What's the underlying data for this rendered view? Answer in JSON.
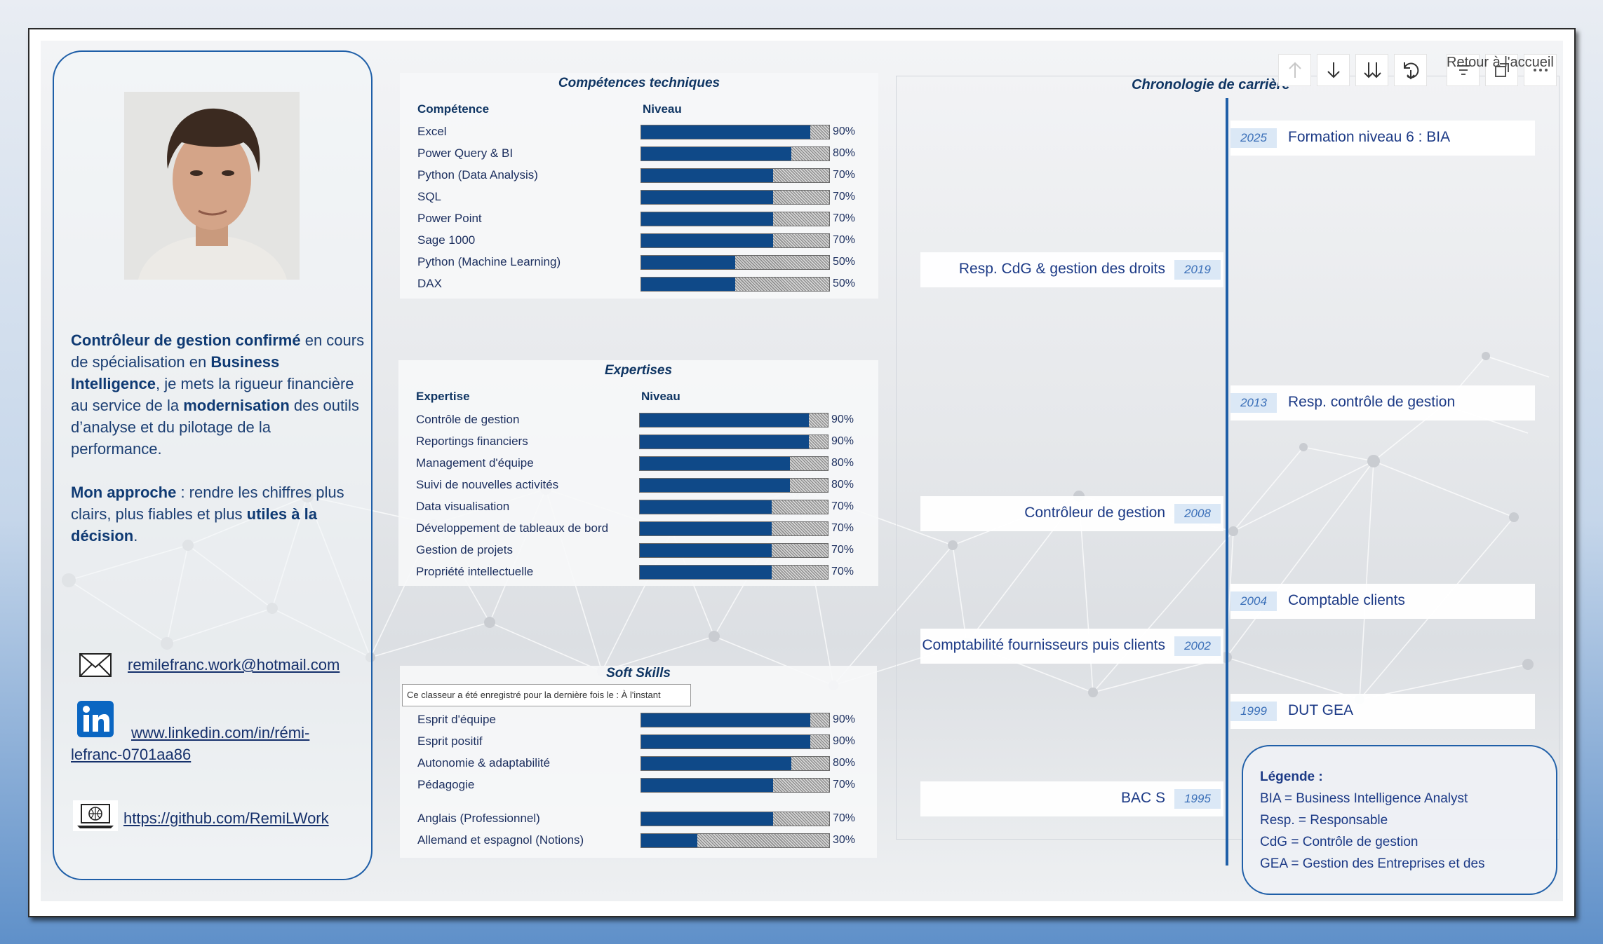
{
  "colors": {
    "accent": "#1f5fa8",
    "bar_fill": "#0f4988",
    "title": "#0f3563",
    "year_badge": "#dbe8f6"
  },
  "profile": {
    "bio_parts": [
      {
        "text": "Contrôleur de gestion confirmé",
        "bold": true
      },
      {
        "text": " en cours de spécialisation en ",
        "bold": false
      },
      {
        "text": "Business Intelligence",
        "bold": true
      },
      {
        "text": ", je mets la rigueur financière au service de la ",
        "bold": false
      },
      {
        "text": "modernisation",
        "bold": true
      },
      {
        "text": " des outils d’analyse et du pilotage de la performance.",
        "bold": false
      }
    ],
    "approach_parts": [
      {
        "text": "Mon approche",
        "bold": true
      },
      {
        "text": " : rendre les chiffres plus clairs, plus fiables et plus ",
        "bold": false
      },
      {
        "text": "utiles à la décision",
        "bold": true
      },
      {
        "text": ".",
        "bold": false
      }
    ],
    "email": "remilefranc.work@hotmail.com",
    "linkedin": "www.linkedin.com/in/rémi-lefranc-0701aa86",
    "github": "https://github.com/RemiLWork",
    "email_icon": "envelope-icon",
    "linkedin_icon": "linkedin-icon",
    "github_icon": "laptop-globe-icon"
  },
  "technical": {
    "title": "Compétences techniques",
    "col_skill": "Compétence",
    "col_level": "Niveau",
    "rows": [
      {
        "label": "Excel",
        "value": 90,
        "text": "90%"
      },
      {
        "label": "Power Query & BI",
        "value": 80,
        "text": "80%"
      },
      {
        "label": "Python (Data Analysis)",
        "value": 70,
        "text": "70%"
      },
      {
        "label": "SQL",
        "value": 70,
        "text": "70%"
      },
      {
        "label": "Power Point",
        "value": 70,
        "text": "70%"
      },
      {
        "label": "Sage 1000",
        "value": 70,
        "text": "70%"
      },
      {
        "label": "Python (Machine Learning)",
        "value": 50,
        "text": "50%"
      },
      {
        "label": "DAX",
        "value": 50,
        "text": "50%"
      }
    ]
  },
  "expertise": {
    "title": "Expertises",
    "col_skill": "Expertise",
    "col_level": "Niveau",
    "rows": [
      {
        "label": "Contrôle de gestion",
        "value": 90,
        "text": "90%"
      },
      {
        "label": "Reportings financiers",
        "value": 90,
        "text": "90%"
      },
      {
        "label": "Management d'équipe",
        "value": 80,
        "text": "80%"
      },
      {
        "label": "Suivi de nouvelles activités",
        "value": 80,
        "text": "80%"
      },
      {
        "label": "Data visualisation",
        "value": 70,
        "text": "70%"
      },
      {
        "label": "Développement de tableaux de bord",
        "value": 70,
        "text": "70%"
      },
      {
        "label": "Gestion de projets",
        "value": 70,
        "text": "70%"
      },
      {
        "label": "Propriété intellectuelle",
        "value": 70,
        "text": "70%"
      }
    ]
  },
  "soft": {
    "title": "Soft Skills",
    "rows": [
      {
        "label": "Esprit d'équipe",
        "value": 90,
        "text": "90%"
      },
      {
        "label": "Esprit positif",
        "value": 90,
        "text": "90%"
      },
      {
        "label": "Autonomie & adaptabilité",
        "value": 80,
        "text": "80%"
      },
      {
        "label": "Pédagogie",
        "value": 70,
        "text": "70%"
      },
      {
        "label": "Anglais (Professionnel)",
        "value": 70,
        "text": "70%"
      },
      {
        "label": "Allemand et espagnol (Notions)",
        "value": 30,
        "text": "30%"
      }
    ]
  },
  "tooltip": "Ce classeur a été enregistré pour la dernière fois le : À l'instant",
  "timeline": {
    "title": "Chronologie de carrière",
    "events": [
      {
        "year": "2025",
        "text": "Formation niveau 6 : BIA",
        "side": "right"
      },
      {
        "year": "2019",
        "text": "Resp. CdG & gestion des droits",
        "side": "left"
      },
      {
        "year": "2013",
        "text": "Resp. contrôle de gestion",
        "side": "right"
      },
      {
        "year": "2008",
        "text": "Contrôleur de gestion",
        "side": "left"
      },
      {
        "year": "2004",
        "text": "Comptable clients",
        "side": "right"
      },
      {
        "year": "2002",
        "text": "Comptabilité fournisseurs puis clients",
        "side": "left"
      },
      {
        "year": "1999",
        "text": "DUT GEA",
        "side": "right"
      },
      {
        "year": "1995",
        "text": "BAC S",
        "side": "left"
      }
    ]
  },
  "legend": {
    "title": "Légende :",
    "items": [
      "BIA = Business Intelligence Analyst",
      "Resp. = Responsable",
      "CdG = Contrôle de gestion",
      "GEA = Gestion des Entreprises et des"
    ]
  },
  "toolbar": {
    "home_label": "Retour à l'accueil",
    "buttons": [
      "arrow-up-icon",
      "arrow-down-icon",
      "double-arrow-down-icon",
      "drill-icon",
      "filter-icon",
      "focus-icon",
      "more-icon"
    ]
  }
}
